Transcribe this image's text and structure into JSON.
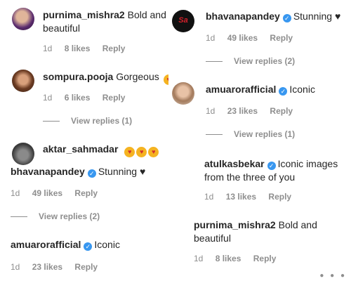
{
  "left": {
    "comments": [
      {
        "user": "purnima_mishra2",
        "text": "Bold and",
        "text2": "beautiful",
        "time": "1d",
        "likes": "8 likes",
        "reply": "Reply"
      },
      {
        "user": "sompura.pooja",
        "text": "Gorgeous",
        "time": "1d",
        "likes": "6 likes",
        "reply": "Reply",
        "replies": "View replies (1)"
      },
      {
        "user": "aktar_sahmadar",
        "emojis": [
          "😍",
          "😍",
          "😍"
        ]
      },
      {
        "user": "bhavanapandey",
        "text": "Stunning ♥",
        "time": "1d",
        "likes": "49 likes",
        "reply": "Reply",
        "replies": "View replies (2)"
      },
      {
        "user": "amuarorafficial",
        "text": "Iconic",
        "time": "1d",
        "likes": "23 likes",
        "reply": "Reply"
      }
    ]
  },
  "right": {
    "comments": [
      {
        "user": "bhavanapandey",
        "text": "Stunning ♥",
        "time": "1d",
        "likes": "49 likes",
        "reply": "Reply",
        "replies": "View replies (2)"
      },
      {
        "user": "amuarorafficial",
        "text": "Iconic",
        "time": "1d",
        "likes": "23 likes",
        "reply": "Reply",
        "replies": "View replies (1)"
      },
      {
        "user": "atulkasbekar",
        "text": "Iconic images",
        "text2": "from the three of you",
        "time": "1d",
        "likes": "13 likes",
        "reply": "Reply"
      },
      {
        "user": "purnima_mishra2",
        "text": "Bold and",
        "text2": "beautiful",
        "time": "1d",
        "likes": "8 likes",
        "reply": "Reply"
      }
    ]
  },
  "colors": {
    "verified": "#3897f0",
    "meta": "#8e8e8e",
    "text": "#262626"
  }
}
